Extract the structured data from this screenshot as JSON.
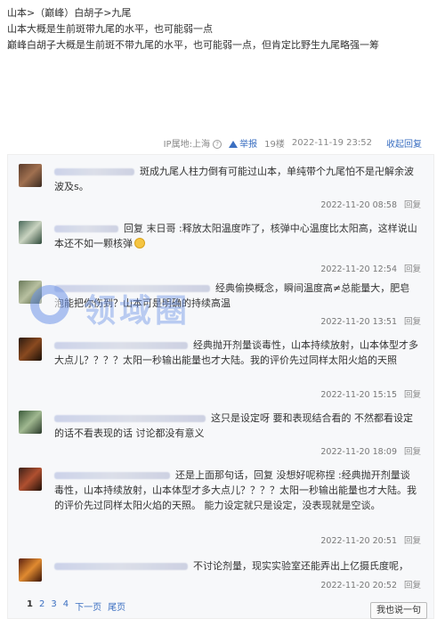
{
  "post": {
    "lines": [
      "山本>（巅峰）白胡子>九尾",
      "山本大概是生前斑带九尾的水平，也可能弱一点",
      "巅峰白胡子大概是生前斑不带九尾的水平，也可能弱一点，但肯定比野生九尾略强一筹"
    ],
    "ip": "IP属地:上海",
    "report": "举报",
    "floor": "19楼",
    "time": "2022-11-19 23:52",
    "fold": "收起回复"
  },
  "replies": [
    {
      "text": "斑成九尾人柱力倒有可能过山本，单纯带个九尾怕不是卍解余波波及s。",
      "time": "2022-11-20 08:58",
      "reply_btn": "回复"
    },
    {
      "prefix": "回复 末日哥 :",
      "text": "释放太阳温度咋了，核弹中心温度比太阳高，这样说山本还不如一颗核弹",
      "time": "2022-11-20 12:54",
      "reply_btn": "回复"
    },
    {
      "text": "经典偷换概念，瞬间温度高≠总能量大，肥皂泡能把你伤到？山本可是明确的持续高温",
      "time": "2022-11-20 13:51",
      "reply_btn": "回复"
    },
    {
      "text": "经典抛开剂量谈毒性，山本持续放射，山本体型才多大点儿？？？？太阳一秒输出能量也才大陆。我的评价先过同样太阳火焰的天照",
      "time": "2022-11-20 15:15",
      "reply_btn": "回复"
    },
    {
      "text": "这只是设定呀 要和表现结合看的 不然都看设定的话不看表现的话 讨论都没有意义",
      "time": "2022-11-20 18:09",
      "reply_btn": "回复"
    },
    {
      "text": "还是上面那句话，回复 没想好呢称捏 :经典抛开剂量谈毒性，山本持续放射，山本体型才多大点儿？？？？太阳一秒输出能量也才大陆。我的评价先过同样太阳火焰的天照。 能力设定就只是设定，没表现就是空谈。",
      "time": "2022-11-20 20:51",
      "reply_btn": "回复"
    },
    {
      "text": "不讨论剂量，现实实验室还能弄出上亿摄氏度呢，",
      "time": "2022-11-20 20:52",
      "reply_btn": "回复"
    }
  ],
  "watermark": "领域圈",
  "pager": {
    "pages": [
      "1",
      "2",
      "3",
      "4"
    ],
    "next": "下一页",
    "last": "尾页"
  },
  "say_button": "我也说一句",
  "colors": {
    "link": "#3b6fc1",
    "panel_bg": "#f7f8fa"
  }
}
